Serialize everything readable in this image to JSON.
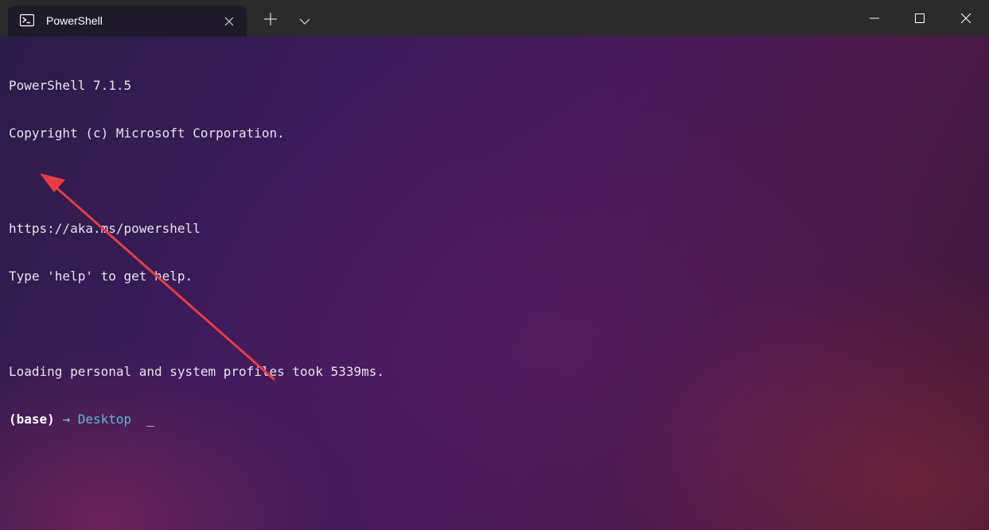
{
  "window": {
    "tab_title": "PowerShell",
    "tab_icon": "powershell-icon",
    "new_tab_icon": "plus-icon",
    "dropdown_icon": "chevron-down-icon",
    "minimize_icon": "minimize-icon",
    "maximize_icon": "maximize-icon",
    "close_icon": "close-icon"
  },
  "terminal": {
    "lines": [
      "PowerShell 7.1.5",
      "Copyright (c) Microsoft Corporation.",
      "",
      "https://aka.ms/powershell",
      "Type 'help' to get help.",
      "",
      "Loading personal and system profiles took 5339ms."
    ],
    "prompt": {
      "env": "(base)",
      "arrow": "→",
      "directory": "Desktop",
      "cursor": "_"
    }
  },
  "annotation": {
    "type": "red-arrow",
    "color": "#f0393e"
  }
}
